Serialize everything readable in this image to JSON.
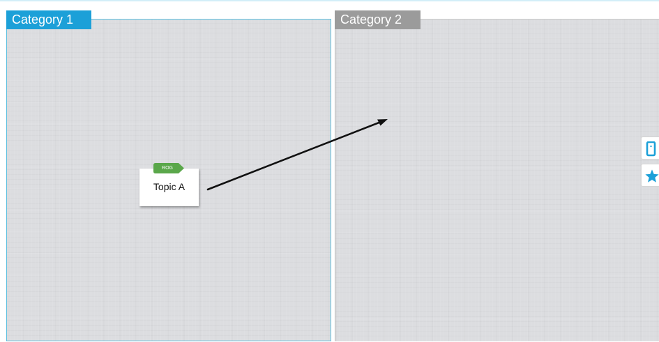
{
  "categories": [
    {
      "label": "Category 1",
      "color": "#1ca0d8"
    },
    {
      "label": "Category 2",
      "color": "#9b9b9b"
    }
  ],
  "topic": {
    "label": "Topic A",
    "tag": "ROG",
    "tag_color": "#5aa74a"
  },
  "connector": {
    "from": "Topic A",
    "to": "Category 2",
    "icon": "arrow"
  },
  "side_toolbar": [
    {
      "icon": "tablet-icon",
      "color": "#1ca0d8"
    },
    {
      "icon": "star-icon",
      "color": "#1ca0d8"
    }
  ]
}
